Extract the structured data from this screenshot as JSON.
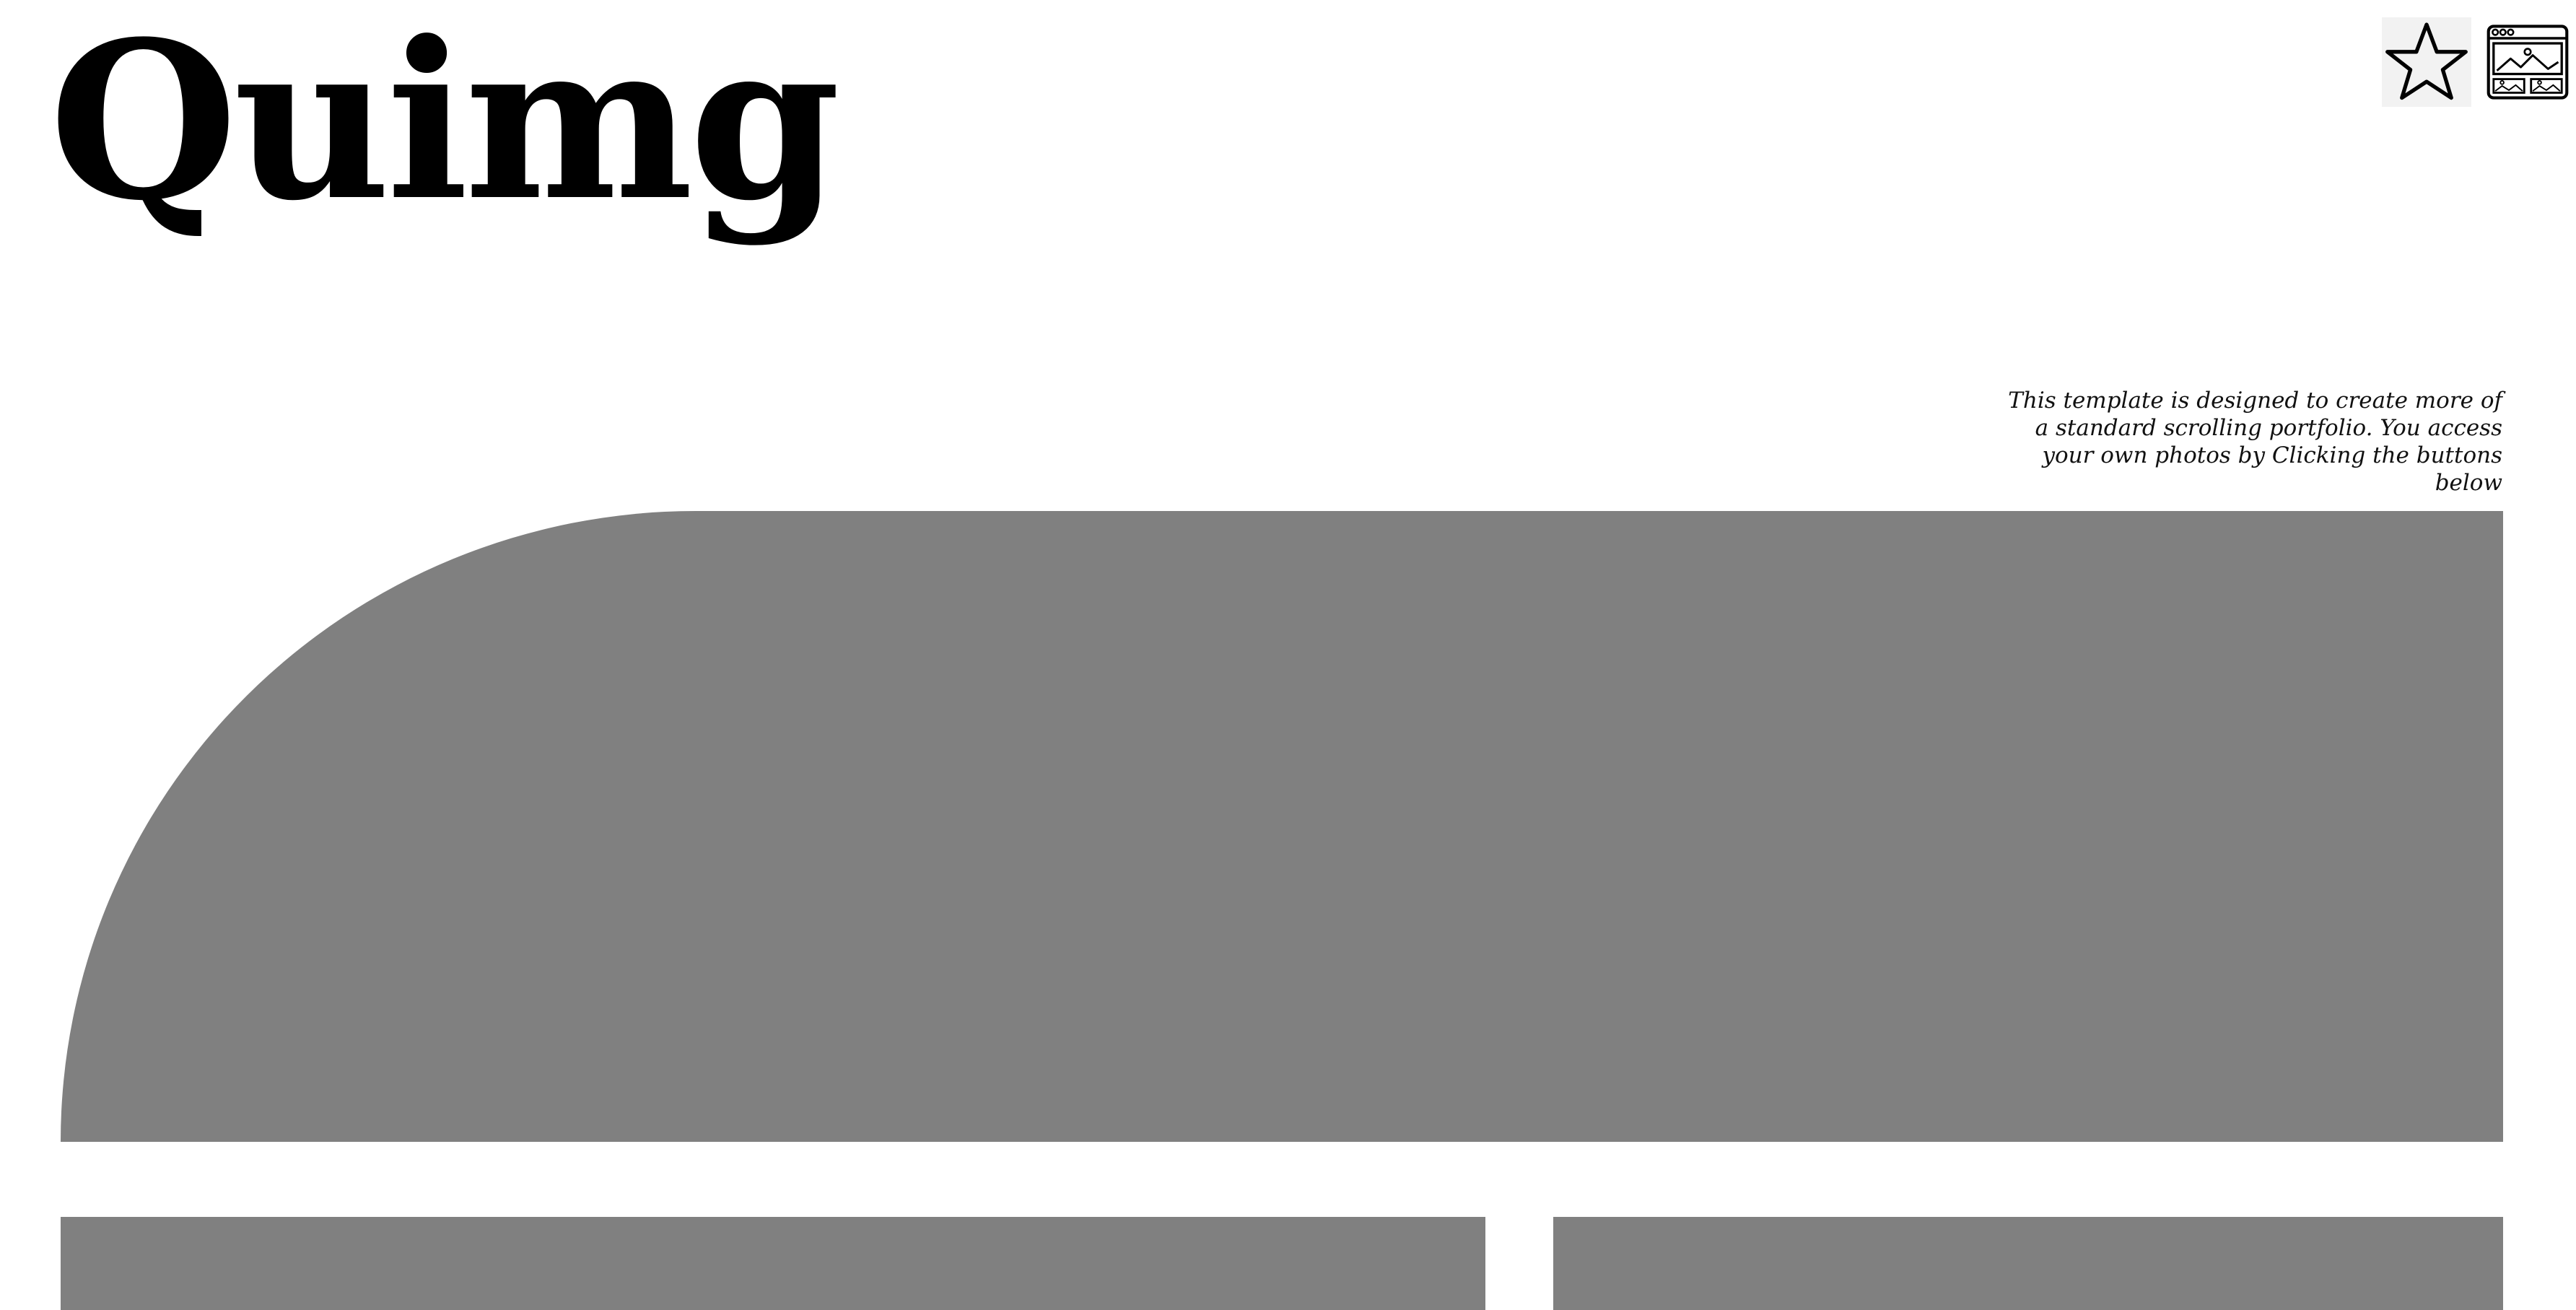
{
  "site": {
    "logo_text": "Quimg"
  },
  "header_buttons": [
    {
      "icon": "star-icon"
    },
    {
      "icon": "gallery-window-icon"
    }
  ],
  "intro": {
    "text": "This template is designed to create more of a standard scrolling portfolio. You access your own photos by Clicking the buttons below"
  },
  "colors": {
    "placeholder_gray": "#808080",
    "background": "#ffffff",
    "text": "#000000",
    "button_bg": "#f2f2f2"
  }
}
